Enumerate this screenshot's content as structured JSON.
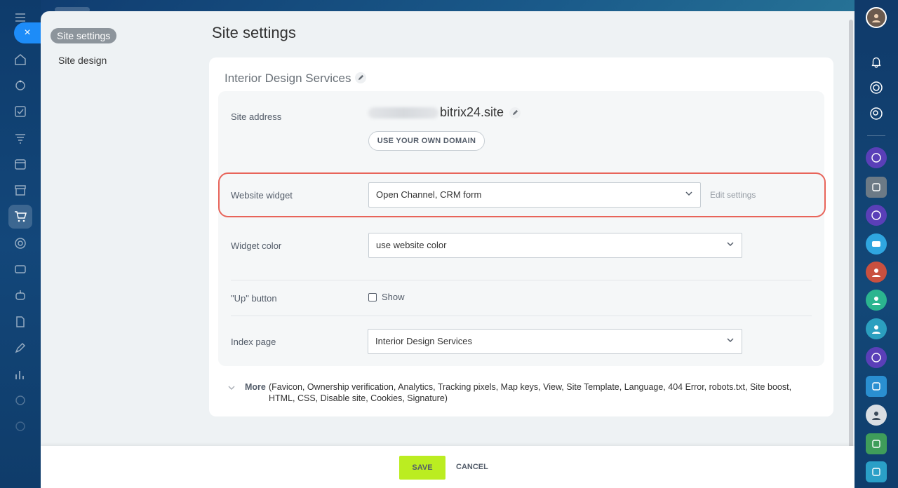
{
  "left_rail": {
    "close_label": "×",
    "icons": [
      "menu-icon",
      "home-icon",
      "crm-icon",
      "tasks-icon",
      "filter-icon",
      "calendar-icon",
      "store-icon",
      "cart-icon",
      "target-icon",
      "id-card-icon",
      "robot-icon",
      "document-sign-icon",
      "pen-icon",
      "chart-icon",
      "shield-icon",
      "settings-icon"
    ]
  },
  "right_rail": {
    "icons": [
      "user-avatar",
      "bell-icon",
      "copilot-icon",
      "chat-search-icon",
      "chat-avatar-1",
      "chat-avatar-2",
      "chat-avatar-3",
      "chat-avatar-4",
      "chat-avatar-5",
      "chat-avatar-6",
      "chat-avatar-7",
      "chat-avatar-8",
      "chat-avatar-9",
      "chat-avatar-10",
      "chat-avatar-11",
      "chat-avatar-12"
    ]
  },
  "menu": {
    "active": "Site settings",
    "items": [
      "Site design"
    ]
  },
  "page": {
    "title": "Site settings"
  },
  "site": {
    "name": "Interior Design Services",
    "address_label": "Site address",
    "address_domain": "bitrix24.site",
    "own_domain_button": "USE YOUR OWN DOMAIN"
  },
  "widget": {
    "label": "Website widget",
    "value": "Open Channel, CRM form",
    "edit_link": "Edit settings"
  },
  "widget_color": {
    "label": "Widget color",
    "value": "use website color"
  },
  "up_button": {
    "label": "\"Up\" button",
    "checkbox_label": "Show"
  },
  "index_page": {
    "label": "Index page",
    "value": "Interior Design Services"
  },
  "more": {
    "label": "More",
    "text": "(Favicon,  Ownership verification,  Analytics,  Tracking pixels,  Map keys,  View,  Site Template,  Language,  404 Error,  robots.txt,  Site boost,  HTML,  CSS,  Disable site,  Cookies,  Signature)"
  },
  "footer": {
    "save": "SAVE",
    "cancel": "CANCEL"
  },
  "colors": {
    "save_button": "#bbed21",
    "highlight": "#e8645a",
    "close_button": "#1d8cf8"
  }
}
